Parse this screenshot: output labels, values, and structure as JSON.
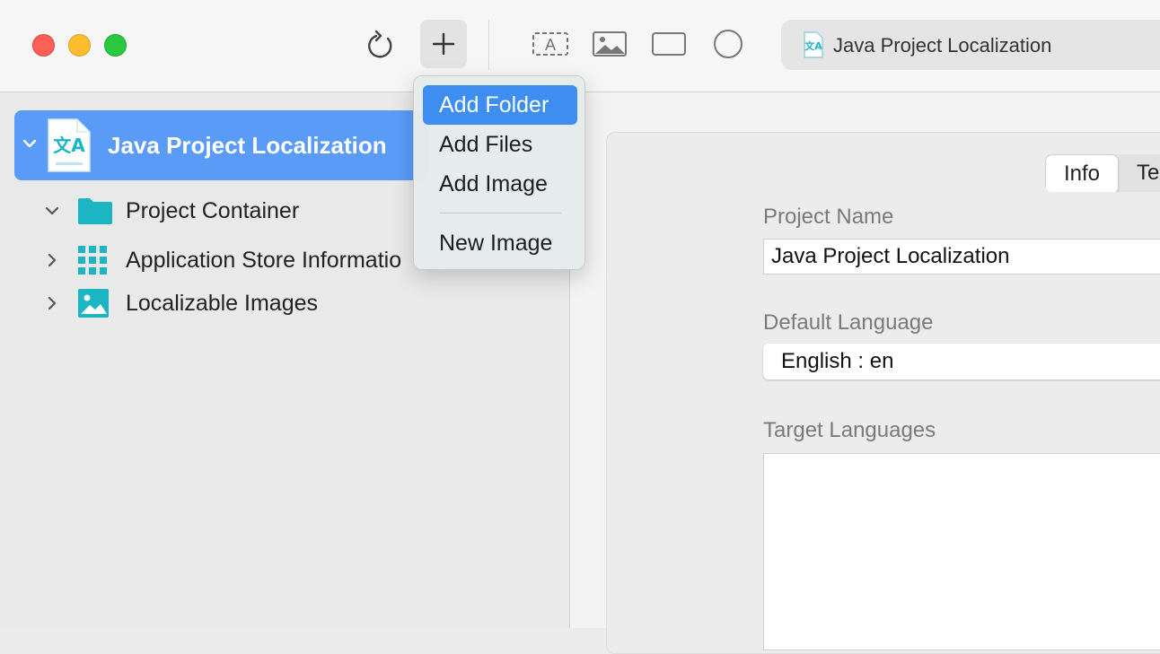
{
  "window": {
    "title": "Java Project Localization"
  },
  "toolbar": {
    "reload_icon": "reload-icon",
    "add_icon": "plus-icon",
    "tools": [
      "text-tool-icon",
      "image-tool-icon",
      "rectangle-tool-icon",
      "circle-tool-icon"
    ]
  },
  "add_menu": {
    "items": [
      {
        "label": "Add Folder",
        "highlighted": true
      },
      {
        "label": "Add Files"
      },
      {
        "label": "Add Image"
      },
      {
        "label": "New Image"
      }
    ]
  },
  "sidebar": {
    "root": {
      "label": "Java Project Localization",
      "expanded": true,
      "selected": true
    },
    "items": [
      {
        "label": "Project Container",
        "icon": "folder-icon",
        "expanded": true
      },
      {
        "label": "Application Store Informatio",
        "icon": "grid-icon",
        "expanded": false
      },
      {
        "label": "Localizable Images",
        "icon": "image-icon",
        "expanded": false
      }
    ]
  },
  "main": {
    "tabs": [
      {
        "label": "Info",
        "active": true
      },
      {
        "label": "Texts",
        "active": false
      }
    ],
    "fields": {
      "project_name_label": "Project Name",
      "project_name_value": "Java Project Localization",
      "default_language_label": "Default Language",
      "default_language_value": "English : en",
      "target_languages_label": "Target Languages"
    }
  },
  "colors": {
    "accent": "#3d8ef0",
    "selection": "#5a9bf8",
    "teal_icon": "#1bb5c4",
    "close": "#fe5f57",
    "minimize": "#febc2e",
    "maximize": "#28c840"
  }
}
